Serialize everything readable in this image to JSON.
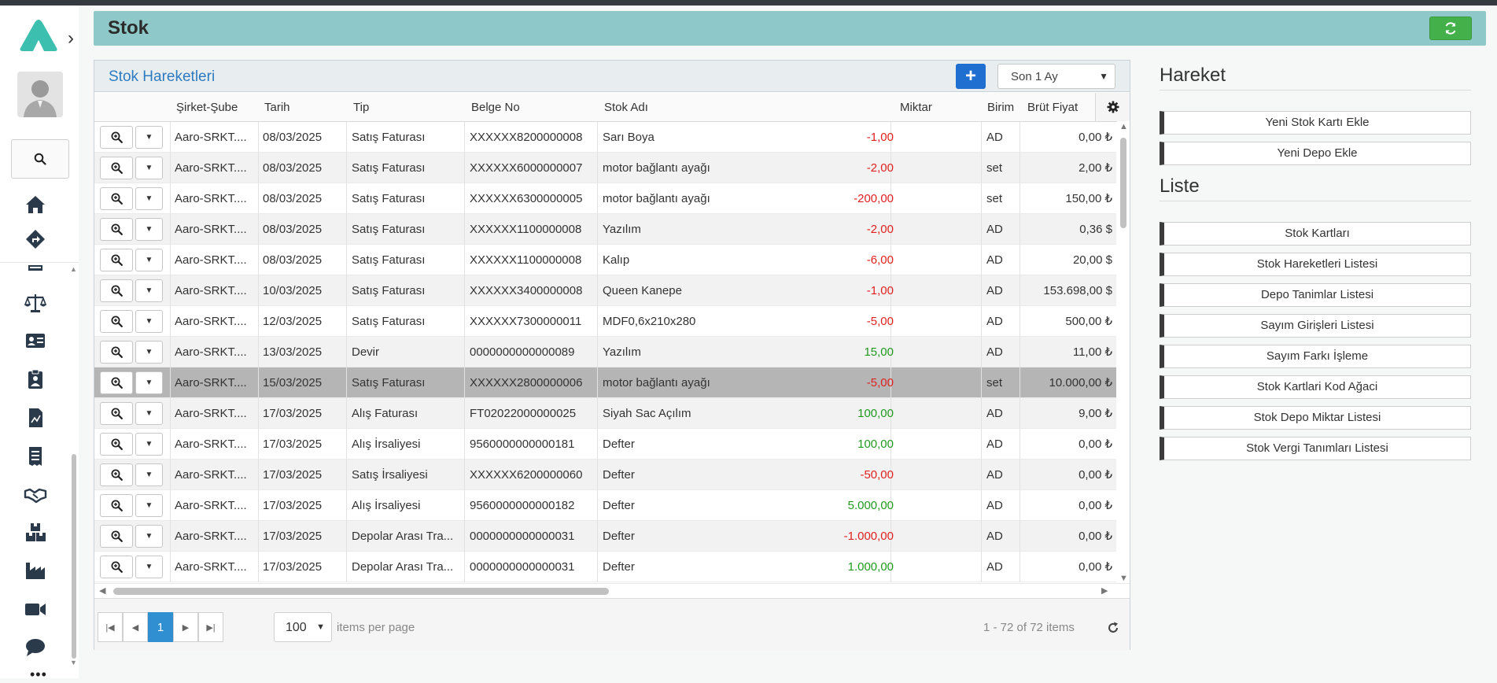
{
  "header": {
    "title": "Stok"
  },
  "panel": {
    "title": "Stok Hareketleri",
    "period": "Son 1 Ay",
    "columns": [
      "Şirket-Şube",
      "Tarih",
      "Tip",
      "Belge No",
      "Stok Adı",
      "Miktar",
      "Birim",
      "Brüt Fiyat"
    ],
    "rows": [
      {
        "sirket": "Aaro-SRKT....",
        "tarih": "08/03/2025",
        "tip": "Satış Faturası",
        "belge": "XXXXXX8200000008",
        "stok": "Sarı Boya",
        "miktar": "-1,00",
        "sign": "neg",
        "birim": "AD",
        "fiyat": "0,00 ₺"
      },
      {
        "sirket": "Aaro-SRKT....",
        "tarih": "08/03/2025",
        "tip": "Satış Faturası",
        "belge": "XXXXXX6000000007",
        "stok": "motor bağlantı ayağı",
        "miktar": "-2,00",
        "sign": "neg",
        "birim": "set",
        "fiyat": "2,00 ₺"
      },
      {
        "sirket": "Aaro-SRKT....",
        "tarih": "08/03/2025",
        "tip": "Satış Faturası",
        "belge": "XXXXXX6300000005",
        "stok": "motor bağlantı ayağı",
        "miktar": "-200,00",
        "sign": "neg",
        "birim": "set",
        "fiyat": "150,00 ₺"
      },
      {
        "sirket": "Aaro-SRKT....",
        "tarih": "08/03/2025",
        "tip": "Satış Faturası",
        "belge": "XXXXXX1100000008",
        "stok": "Yazılım",
        "miktar": "-2,00",
        "sign": "neg",
        "birim": "AD",
        "fiyat": "0,36 $"
      },
      {
        "sirket": "Aaro-SRKT....",
        "tarih": "08/03/2025",
        "tip": "Satış Faturası",
        "belge": "XXXXXX1100000008",
        "stok": "Kalıp",
        "miktar": "-6,00",
        "sign": "neg",
        "birim": "AD",
        "fiyat": "20,00 $"
      },
      {
        "sirket": "Aaro-SRKT....",
        "tarih": "10/03/2025",
        "tip": "Satış Faturası",
        "belge": "XXXXXX3400000008",
        "stok": "Queen Kanepe",
        "miktar": "-1,00",
        "sign": "neg",
        "birim": "AD",
        "fiyat": "153.698,00 $"
      },
      {
        "sirket": "Aaro-SRKT....",
        "tarih": "12/03/2025",
        "tip": "Satış Faturası",
        "belge": "XXXXXX7300000011",
        "stok": "MDF0,6x210x280",
        "miktar": "-5,00",
        "sign": "neg",
        "birim": "AD",
        "fiyat": "500,00 ₺"
      },
      {
        "sirket": "Aaro-SRKT....",
        "tarih": "13/03/2025",
        "tip": "Devir",
        "belge": "0000000000000089",
        "stok": "Yazılım",
        "miktar": "15,00",
        "sign": "pos",
        "birim": "AD",
        "fiyat": "11,00 ₺"
      },
      {
        "sirket": "Aaro-SRKT....",
        "tarih": "15/03/2025",
        "tip": "Satış Faturası",
        "belge": "XXXXXX2800000006",
        "stok": "motor bağlantı ayağı",
        "miktar": "-5,00",
        "sign": "neg",
        "birim": "set",
        "fiyat": "10.000,00 ₺"
      },
      {
        "sirket": "Aaro-SRKT....",
        "tarih": "17/03/2025",
        "tip": "Alış Faturası",
        "belge": "FT02022000000025",
        "stok": "Siyah Sac Açılım",
        "miktar": "100,00",
        "sign": "pos",
        "birim": "AD",
        "fiyat": "9,00 ₺"
      },
      {
        "sirket": "Aaro-SRKT....",
        "tarih": "17/03/2025",
        "tip": "Alış İrsaliyesi",
        "belge": "9560000000000181",
        "stok": "Defter",
        "miktar": "100,00",
        "sign": "pos",
        "birim": "AD",
        "fiyat": "0,00 ₺"
      },
      {
        "sirket": "Aaro-SRKT....",
        "tarih": "17/03/2025",
        "tip": "Satış İrsaliyesi",
        "belge": "XXXXXX6200000060",
        "stok": "Defter",
        "miktar": "-50,00",
        "sign": "neg",
        "birim": "AD",
        "fiyat": "0,00 ₺"
      },
      {
        "sirket": "Aaro-SRKT....",
        "tarih": "17/03/2025",
        "tip": "Alış İrsaliyesi",
        "belge": "9560000000000182",
        "stok": "Defter",
        "miktar": "5.000,00",
        "sign": "pos",
        "birim": "AD",
        "fiyat": "0,00 ₺"
      },
      {
        "sirket": "Aaro-SRKT....",
        "tarih": "17/03/2025",
        "tip": "Depolar Arası Tra...",
        "belge": "0000000000000031",
        "stok": "Defter",
        "miktar": "-1.000,00",
        "sign": "neg",
        "birim": "AD",
        "fiyat": "0,00 ₺"
      },
      {
        "sirket": "Aaro-SRKT....",
        "tarih": "17/03/2025",
        "tip": "Depolar Arası Tra...",
        "belge": "0000000000000031",
        "stok": "Defter",
        "miktar": "1.000,00",
        "sign": "pos",
        "birim": "AD",
        "fiyat": "0,00 ₺"
      }
    ],
    "selected_row": 8,
    "pager": {
      "current_page": "1",
      "per_page": "100",
      "per_page_label": "items per page",
      "info": "1 - 72 of 72 items"
    }
  },
  "right": {
    "hareket_title": "Hareket",
    "hareket_items": [
      "Yeni Stok Kartı Ekle",
      "Yeni Depo Ekle"
    ],
    "liste_title": "Liste",
    "liste_items": [
      "Stok Kartları",
      "Stok Hareketleri Listesi",
      "Depo Tanimlar Listesi",
      "Sayım Girişleri Listesi",
      "Sayım Farkı İşleme",
      "Stok Kartlari Kod Ağaci",
      "Stok Depo Miktar Listesi",
      "Stok Vergi Tanımları Listesi"
    ]
  },
  "sidebar": {
    "icons": [
      "home-icon",
      "directions-icon",
      "inventory-icon",
      "balance-scale-icon",
      "id-card-icon",
      "clipboard-user-icon",
      "file-chart-icon",
      "receipt-icon",
      "handshake-icon",
      "boxes-icon",
      "industry-icon",
      "video-icon",
      "chat-icon"
    ]
  },
  "colors": {
    "accent": "#8ec8c8",
    "brand": "#3cbfae",
    "negative": "#e02020",
    "positive": "#1f9a1f",
    "primary": "#1e6fd0",
    "refresh": "#43b04a"
  }
}
